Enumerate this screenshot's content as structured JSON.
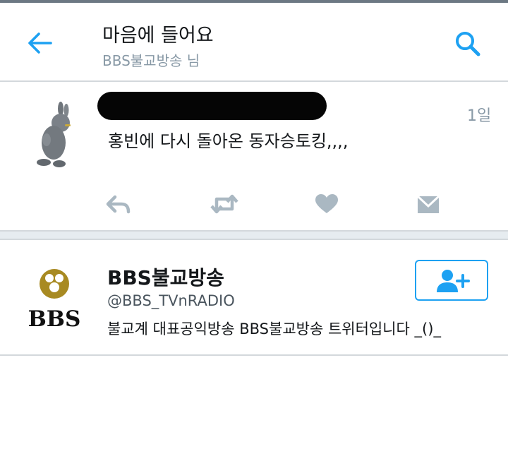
{
  "header": {
    "title": "마음에 들어요",
    "subtitle": "BBS불교방송 님"
  },
  "tweet": {
    "time": "1일",
    "text": "홍빈에 다시 돌아온 동자승토킹,,,,"
  },
  "user": {
    "name": "BBS불교방송",
    "handle": "@BBS_TVnRADIO",
    "bio": "불교계 대표공익방송 BBS불교방송 트위터입니다 _()_",
    "logo_text": "BBS"
  },
  "colors": {
    "accent": "#1da1f2",
    "icon_gray": "#aab8c2",
    "secondary_text": "#8899a6",
    "logo_gold": "#a88a22"
  }
}
